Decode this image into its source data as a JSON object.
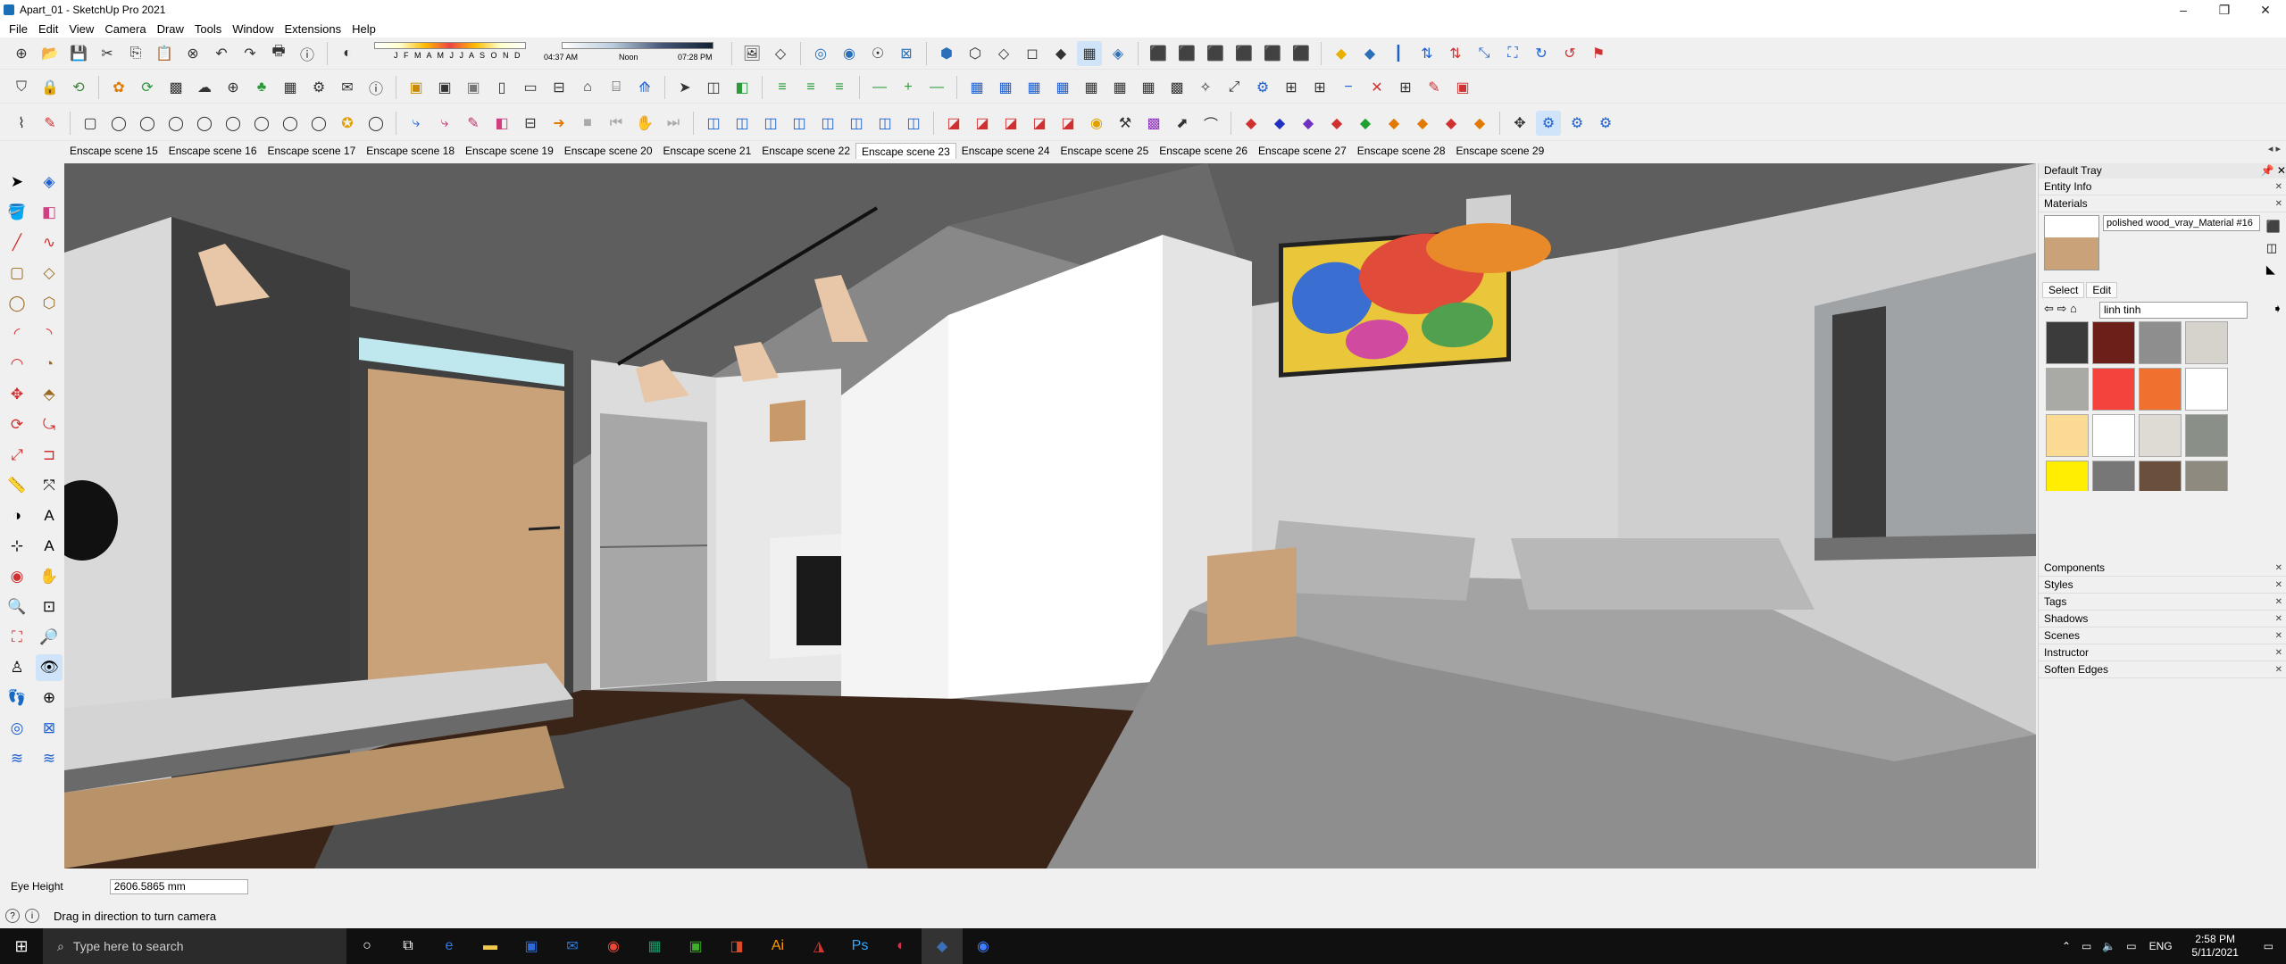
{
  "window": {
    "title": "Apart_01 - SketchUp Pro 2021",
    "minimize": "–",
    "maximize": "❐",
    "close": "✕"
  },
  "menu": [
    "File",
    "Edit",
    "View",
    "Camera",
    "Draw",
    "Tools",
    "Window",
    "Extensions",
    "Help"
  ],
  "shadow": {
    "months": "J F M A M J J A S O N D",
    "time_start": "04:37 AM",
    "time_mid": "Noon",
    "time_end": "07:28 PM"
  },
  "scenes": {
    "tabs": [
      "Enscape scene 15",
      "Enscape scene 16",
      "Enscape scene 17",
      "Enscape scene 18",
      "Enscape scene 19",
      "Enscape scene 20",
      "Enscape scene 21",
      "Enscape scene 22",
      "Enscape scene 23",
      "Enscape scene 24",
      "Enscape scene 25",
      "Enscape scene 26",
      "Enscape scene 27",
      "Enscape scene 28",
      "Enscape scene 29"
    ],
    "active": "Enscape scene 23"
  },
  "tray": {
    "title": "Default Tray",
    "entity_info": "Entity Info",
    "materials": "Materials",
    "material_name": "polished wood_vray_Material #16",
    "select_tab": "Select",
    "edit_tab": "Edit",
    "library": "linh tinh",
    "swatch_colors": [
      "#3b3b3b",
      "#6b1f18",
      "#8e8e8e",
      "#d6d3cc",
      "#a9aaa6",
      "#f4433c",
      "#f07030",
      "#ffffff",
      "#fbdb93",
      "#ffffff",
      "#dedbd4",
      "#8a8f88",
      "#ffee00",
      "#777777",
      "#6a4f3c",
      "#8f8a80"
    ],
    "sections": [
      "Components",
      "Styles",
      "Tags",
      "Shadows",
      "Scenes",
      "Instructor",
      "Soften Edges"
    ]
  },
  "measure": {
    "label": "Eye Height",
    "value": "2606.5865 mm"
  },
  "status": {
    "text": "Drag in direction to turn camera"
  },
  "taskbar": {
    "search_placeholder": "Type here to search",
    "lang": "ENG",
    "time": "2:58 PM",
    "date": "5/11/2021",
    "icon_colors": [
      "#ffffff",
      "#ffffff",
      "#2d7be0",
      "#f2c94c",
      "#2f6bd6",
      "#2e7bd8",
      "#e8493b",
      "#1f9a6b",
      "#3fae2a",
      "#d94c2a",
      "#c03a2b",
      "#d8322b",
      "#001e36",
      "#d2334a",
      "#3b6fb6",
      "#4080ff"
    ]
  }
}
